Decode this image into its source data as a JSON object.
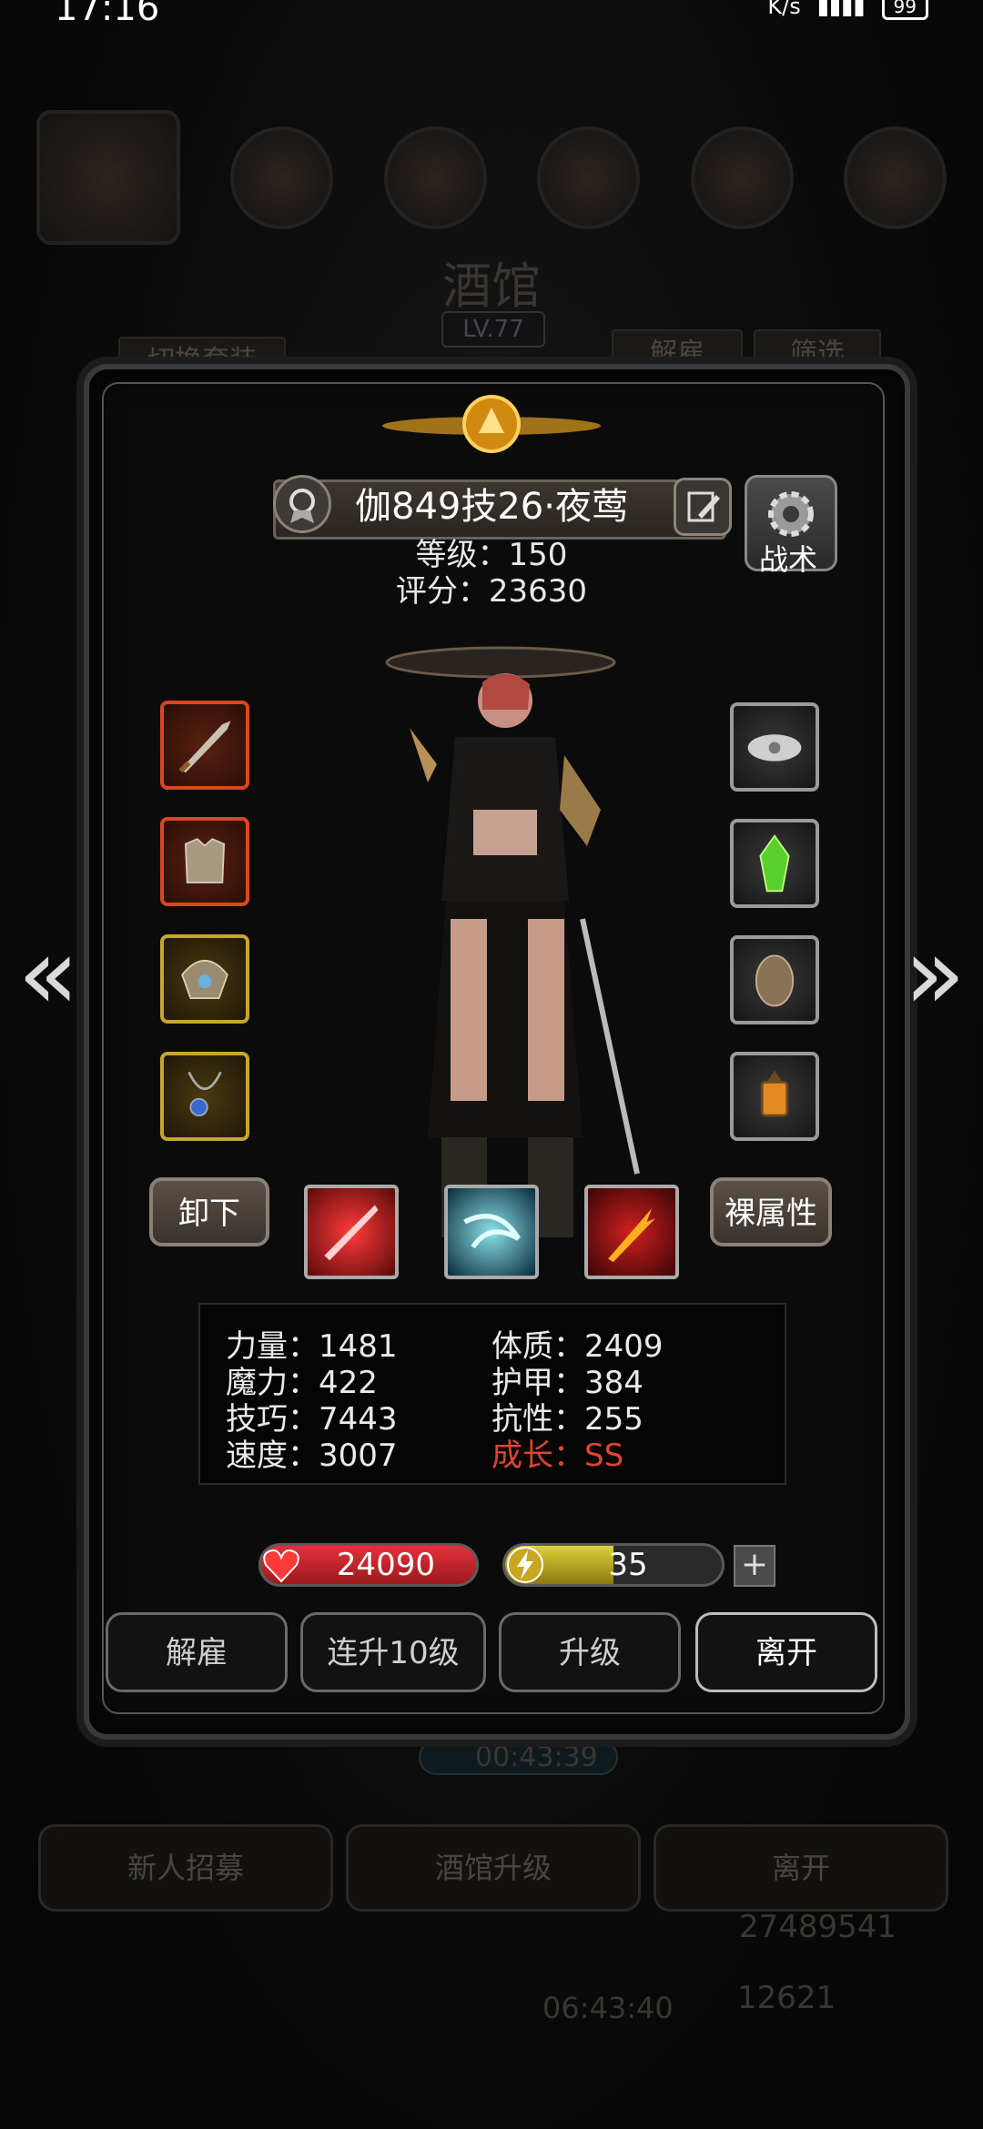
{
  "status_bar": {
    "time": "17:16",
    "speed": "K/s",
    "battery": "99"
  },
  "background": {
    "title": "酒馆",
    "level": "LV.77",
    "switch_outfit": "切换套装",
    "dismiss": "解雇",
    "filter": "筛选",
    "timer": "00:43:39",
    "recruit": "新人招募",
    "upgrade_tavern": "酒馆升级",
    "leave": "离开",
    "timer2": "06:43:40",
    "gold": "27489541",
    "gems": "12621"
  },
  "hero": {
    "name": "伽849技26·夜莺",
    "level": "等级：150",
    "score": "评分：23630",
    "tactic_label": "战术"
  },
  "buttons": {
    "unequip": "卸下",
    "base_attr": "裸属性",
    "dismiss": "解雇",
    "level10": "连升10级",
    "upgrade": "升级",
    "leave": "离开"
  },
  "stats": {
    "strength": "力量：1481",
    "magic": "魔力：422",
    "skill": "技巧：7443",
    "speed": "速度：3007",
    "constitution": "体质：2409",
    "armor": "护甲：384",
    "resistance": "抗性：255",
    "growth": "成长：SS"
  },
  "bars": {
    "hp": "24090",
    "energy": "35",
    "energy_level": 0.5
  },
  "colors": {
    "growth": "#e0442c",
    "hp": "#d52a33",
    "energy": "#d4c438"
  }
}
